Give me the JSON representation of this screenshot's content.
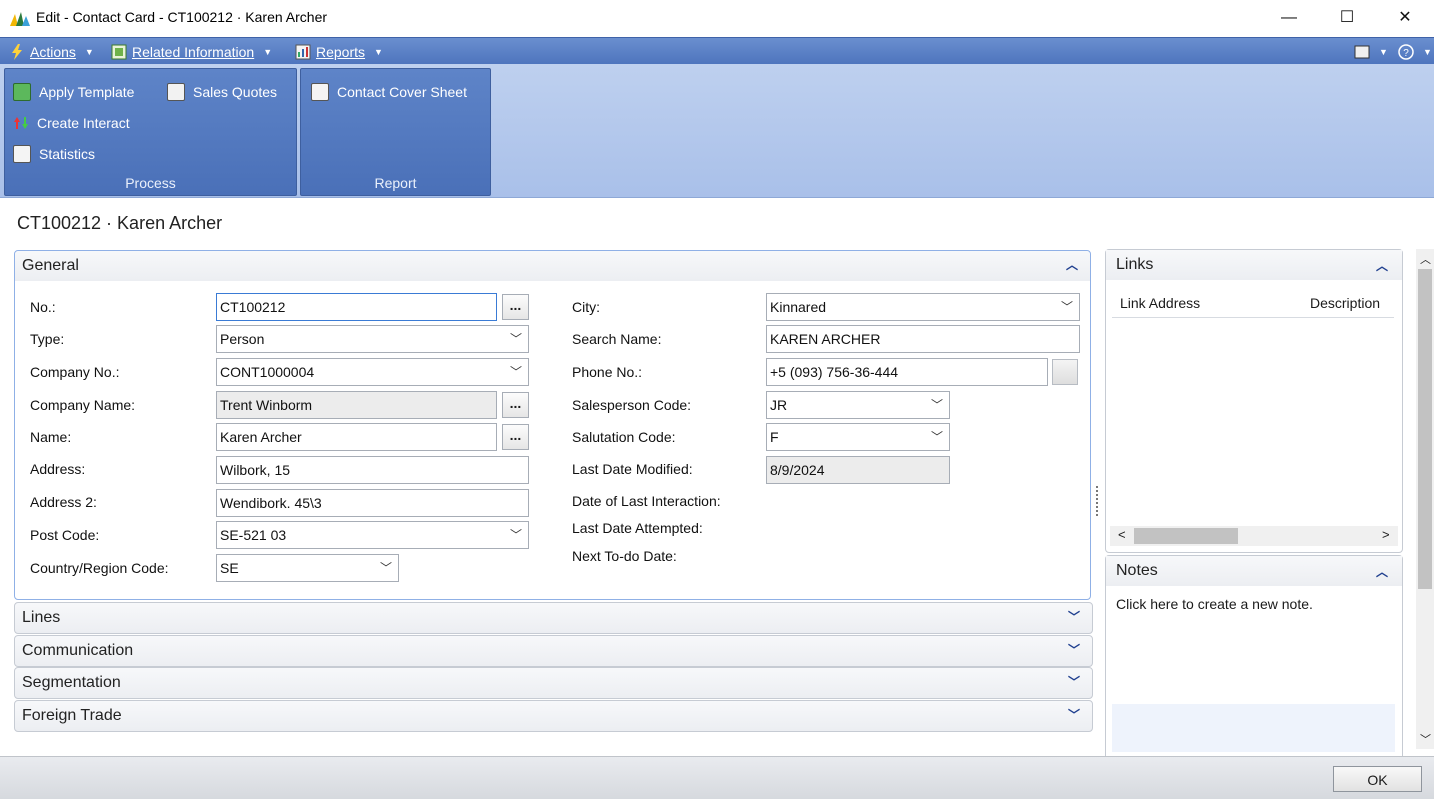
{
  "window": {
    "title": "Edit - Contact Card - CT100212 · Karen Archer",
    "minimize": "—",
    "maximize": "☐",
    "close": "✕"
  },
  "menubar": {
    "actions": "Actions",
    "related": "Related Information",
    "reports": "Reports"
  },
  "ribbon": {
    "process": {
      "label": "Process",
      "apply_template": "Apply Template",
      "sales_quotes": "Sales Quotes",
      "create_interact": "Create Interact",
      "statistics": "Statistics"
    },
    "report": {
      "label": "Report",
      "contact_cover_sheet": "Contact Cover Sheet"
    }
  },
  "page_title": "CT100212 · Karen Archer",
  "general": {
    "title": "General",
    "left": [
      {
        "label": "No.:",
        "value": "CT100212"
      },
      {
        "label": "Type:",
        "value": "Person"
      },
      {
        "label": "Company No.:",
        "value": "CONT1000004"
      },
      {
        "label": "Company Name:",
        "value": "Trent Winborm"
      },
      {
        "label": "Name:",
        "value": "Karen Archer"
      },
      {
        "label": "Address:",
        "value": "Wilbork, 15"
      },
      {
        "label": "Address 2:",
        "value": "Wendibork. 45\\3"
      },
      {
        "label": "Post Code:",
        "value": "SE-521 03"
      },
      {
        "label": "Country/Region Code:",
        "value": "SE"
      }
    ],
    "right": [
      {
        "label": "City:",
        "value": "Kinnared"
      },
      {
        "label": "Search Name:",
        "value": "KAREN ARCHER"
      },
      {
        "label": "Phone No.:",
        "value": "+5 (093) 756-36-444"
      },
      {
        "label": "Salesperson Code:",
        "value": "JR"
      },
      {
        "label": "Salutation Code:",
        "value": "F"
      },
      {
        "label": "Last Date Modified:",
        "value": "8/9/2024"
      },
      {
        "label": "Date of Last Interaction:",
        "value": ""
      },
      {
        "label": "Last Date Attempted:",
        "value": ""
      },
      {
        "label": "Next To-do Date:",
        "value": ""
      }
    ]
  },
  "fasttabs": [
    "Lines",
    "Communication",
    "Segmentation",
    "Foreign Trade"
  ],
  "links": {
    "title": "Links",
    "col_address": "Link Address",
    "col_description": "Description"
  },
  "notes": {
    "title": "Notes",
    "placeholder": "Click here to create a new note."
  },
  "ok": "OK",
  "colors": {
    "menubar": "#5279c0",
    "ribbon_group": "#5077bf",
    "ribbon_bg": "#b4c8ec",
    "focus": "#3a7bd5"
  }
}
